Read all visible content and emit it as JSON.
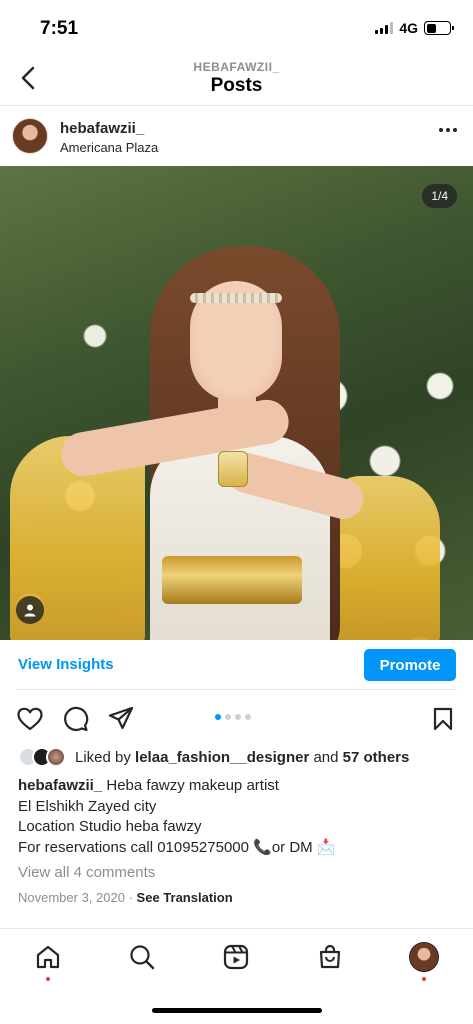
{
  "status_bar": {
    "time": "7:51",
    "network": "4G"
  },
  "nav": {
    "subtitle": "HEBAFAWZII_",
    "title": "Posts"
  },
  "post": {
    "username": "hebafawzii_",
    "location": "Americana Plaza",
    "image_counter": "1/4",
    "carousel": {
      "total": 4,
      "current": 1
    }
  },
  "insights": {
    "link_label": "View Insights",
    "promote_label": "Promote"
  },
  "likes": {
    "prefix": "Liked by",
    "liker": "lelaa_fashion__designer",
    "conjunction": "and",
    "others": "57 others"
  },
  "caption": {
    "username": "hebafawzii_",
    "lines": [
      "Heba fawzy makeup artist",
      "El Elshikh Zayed city",
      "Location Studio heba fawzy",
      "For reservations call 01095275000 📞or DM 📩"
    ]
  },
  "comments_link": "View all 4 comments",
  "date": "November 3, 2020",
  "separator": "·",
  "translate": "See Translation",
  "colors": {
    "accent": "#0095f6",
    "notification": "#ff3040",
    "text": "#262626",
    "muted": "#8e8e8e"
  },
  "icons": [
    "back-arrow-icon",
    "more-icon",
    "user-tag-icon",
    "heart-icon",
    "comment-icon",
    "share-icon",
    "bookmark-icon",
    "home-icon",
    "search-icon",
    "reels-icon",
    "shop-icon"
  ]
}
